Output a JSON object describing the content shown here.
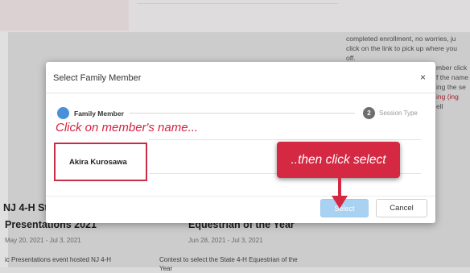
{
  "background": {
    "right_panel_lines": [
      "completed enrollment, no worries, ju",
      "click on the link to pick up where you",
      "off.",
      "mber click",
      "f the name",
      "ing the se",
      "ell"
    ],
    "right_panel_red_fragment": "ing (ing",
    "card1": {
      "title_line1": "NJ 4-H St",
      "title_line2": "Presentations 2021",
      "dates": "May 20, 2021 - Jul 3, 2021",
      "description": "ic Presentations event hosted NJ 4-H"
    },
    "card2": {
      "title": "Equestrian of the Year",
      "dates": "Jun 28, 2021 - Jul 3, 2021",
      "description_line1": "Contest to select the State 4-H Equestrian of the",
      "description_line2": "Year"
    }
  },
  "modal": {
    "title": "Select Family Member",
    "close_label": "×",
    "stepper": {
      "step1_label": "Family Member",
      "step2_number": "2",
      "step2_label": "Session Type"
    },
    "member_name": "Akira Kurosawa",
    "select_label": "Select",
    "cancel_label": "Cancel"
  },
  "annotations": {
    "hint_member": "Click on member's name...",
    "hint_select": "..then click select"
  },
  "colors": {
    "accent_red": "#d42843",
    "step_blue": "#4a90d9",
    "select_disabled": "#a9d2f2"
  }
}
